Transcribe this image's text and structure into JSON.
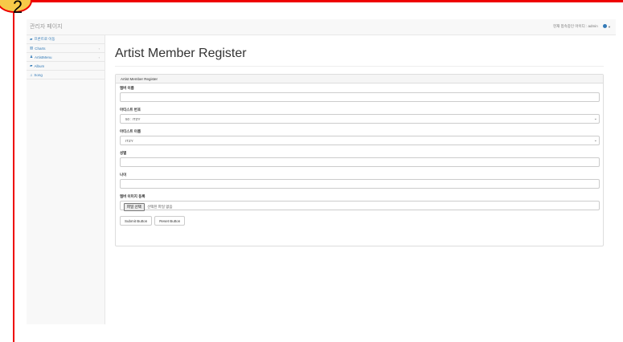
{
  "badge": {
    "number": "2"
  },
  "navbar": {
    "brand": "관리자 페이지",
    "current_user_text": "현재 접속중인 아이디 : admin",
    "caret": "▼"
  },
  "sidebar": {
    "items": [
      {
        "label": "프론트로 이동",
        "icon": "dashboard-icon",
        "has_arrow": false
      },
      {
        "label": "Charts",
        "icon": "bar-chart-icon",
        "has_arrow": true
      },
      {
        "label": "ArtistMenu",
        "icon": "user-icon",
        "has_arrow": true
      },
      {
        "label": "Album",
        "icon": "album-icon",
        "has_arrow": false
      },
      {
        "label": "Song",
        "icon": "music-icon",
        "has_arrow": false
      }
    ]
  },
  "main": {
    "title": "Artist Member Register",
    "panel_heading": "Artist Member Register",
    "fields": {
      "member_name_label": "멤버 이름",
      "member_name_value": "",
      "artist_number_label": "아티스트 번호",
      "artist_number_value": "50 : ITZY",
      "artist_name_label": "아티스트 이름",
      "artist_name_value": "ITZY",
      "gender_label": "성별",
      "gender_value": "",
      "age_label": "나이",
      "age_value": "",
      "profile_image_label": "멤버 이미지 등록",
      "file_button_label": "파일 선택",
      "file_status": "선택된 파일 없음"
    },
    "submit_label": "Submit Button",
    "reset_label": "Reset Button"
  },
  "colors": {
    "accent": "#337ab7",
    "frame": "#ee0000",
    "badge": "#f7c948"
  }
}
